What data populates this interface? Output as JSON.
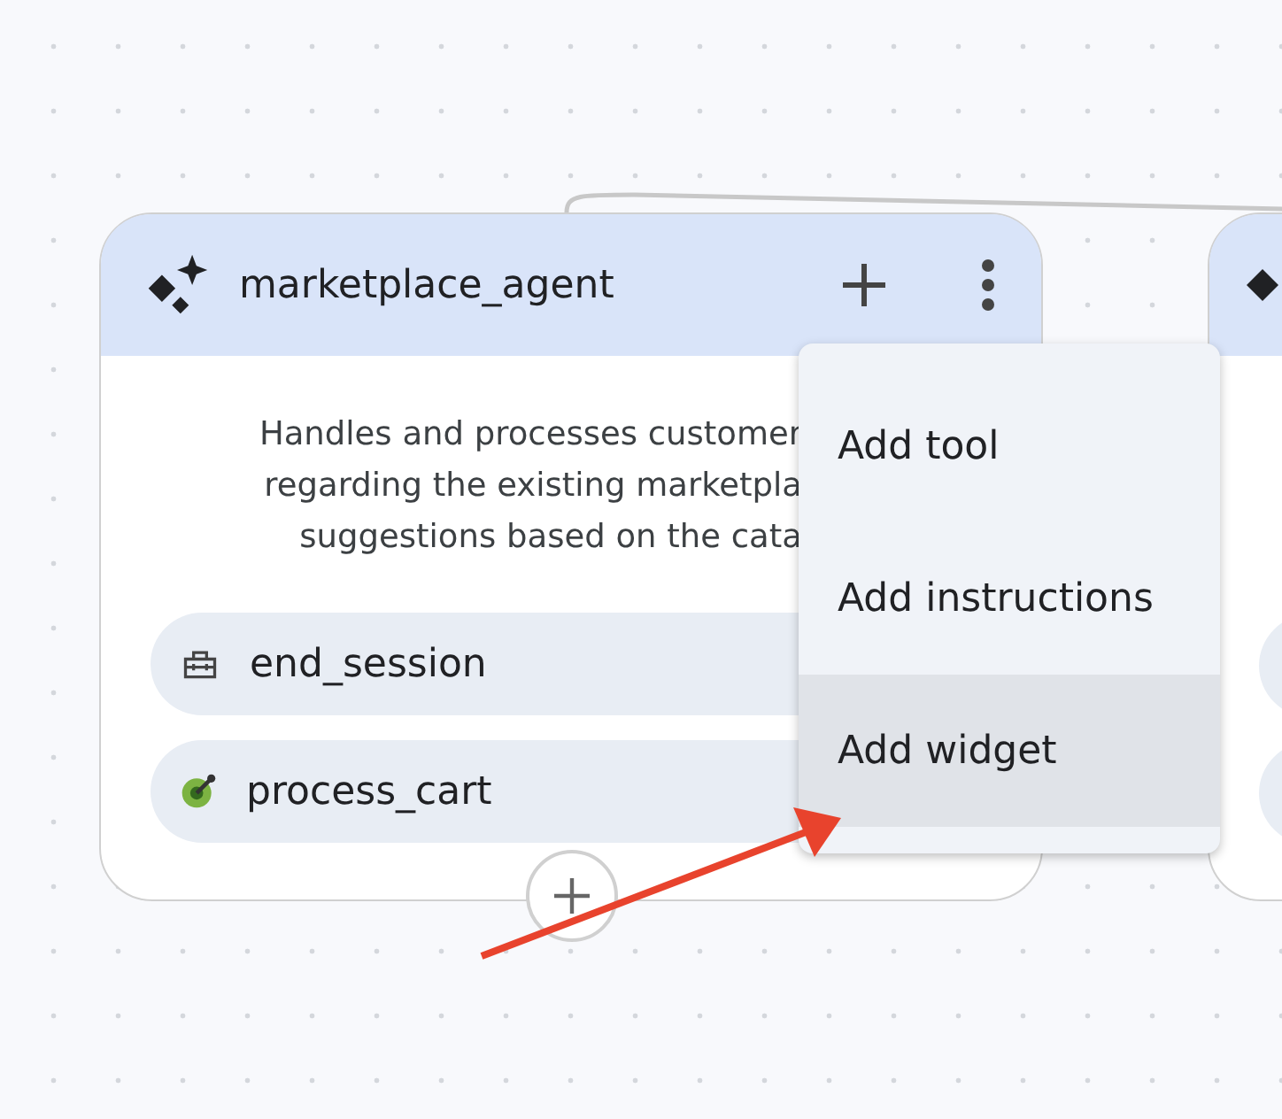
{
  "agent_node": {
    "title": "marketplace_agent",
    "description_lines": [
      "Handles and processes customer",
      "regarding the existing marketpla",
      "suggestions based on the cata"
    ],
    "tools": [
      {
        "kind": "toolbox",
        "name": "end_session"
      },
      {
        "kind": "gauge",
        "name": "process_cart"
      }
    ]
  },
  "menu": {
    "items": [
      {
        "label": "Add tool",
        "selected": false
      },
      {
        "label": "Add instructions",
        "selected": false
      },
      {
        "label": "Add widget",
        "selected": true
      }
    ]
  }
}
